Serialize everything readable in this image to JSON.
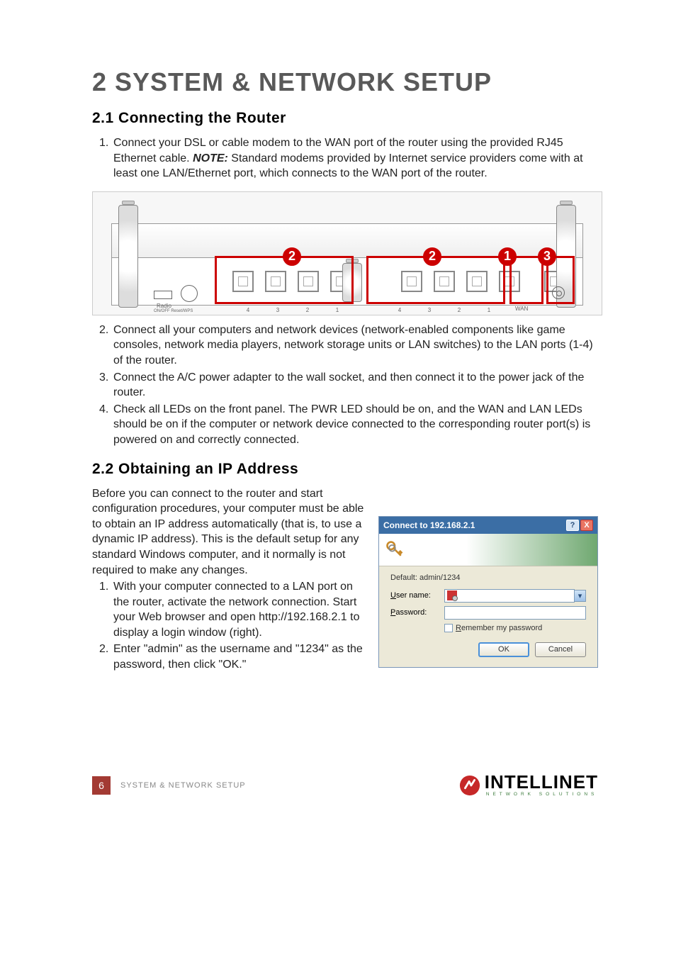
{
  "title": "2 SYSTEM & NETWORK SETUP",
  "section1": {
    "heading": "2.1 Connecting the Router",
    "steps": [
      {
        "num": "1.",
        "pre": "Connect your DSL or cable modem to the WAN port of the router using the provided RJ45 Ethernet cable. ",
        "note_label": "NOTE:",
        "post": " Standard modems provided by Internet service providers come with at least one LAN/Ethernet port, which connects to the WAN port of the router."
      },
      {
        "num": "2.",
        "text": "Connect all your computers and network devices (network-enabled components like game consoles, network media players, network storage units or LAN switches) to the LAN ports (1-4) of the router."
      },
      {
        "num": "3.",
        "text": "Connect the A/C power adapter to the wall socket, and then connect it to the power jack of the router."
      },
      {
        "num": "4.",
        "text": "Check all LEDs on the front panel. The PWR LED should be on, and the WAN and LAN LEDs should be on if the computer or network device connected to the corresponding router port(s) is powered on and correctly connected."
      }
    ]
  },
  "diagram": {
    "radio_label": "Radio",
    "switch_label": "ON/OFF  Reset/WPS",
    "callouts": {
      "a": "2",
      "b": "2",
      "c": "1",
      "d": "3"
    },
    "port_nums": [
      "4",
      "3",
      "2",
      "1"
    ],
    "wan_label": "WAN"
  },
  "section2": {
    "heading": "2.2 Obtaining an IP Address",
    "intro": "Before you can connect to the router and start configuration procedures, your computer must be able to obtain an IP address automatically (that is, to use a dynamic IP address). This is the default setup for any standard Windows computer, and it normally is not required to make any changes.",
    "steps": [
      {
        "num": "1.",
        "text": "With your computer connected to a LAN port on the router, activate the network connection. Start your Web browser and open http://192.168.2.1 to display a login window (right)."
      },
      {
        "num": "2.",
        "text": "Enter \"admin\" as the username and \"1234\" as the password, then click \"OK.\""
      }
    ]
  },
  "dialog": {
    "title": "Connect to 192.168.2.1",
    "realm": "Default: admin/1234",
    "username_label": "User name:",
    "password_label": "Password:",
    "remember": "Remember my password",
    "ok": "OK",
    "cancel": "Cancel",
    "help": "?",
    "close": "X",
    "combo_arrow": "▾"
  },
  "footer": {
    "page": "6",
    "section": "SYSTEM & NETWORK SETUP",
    "brand": "INTELLINET",
    "brand_sub": "NETWORK SOLUTIONS"
  }
}
